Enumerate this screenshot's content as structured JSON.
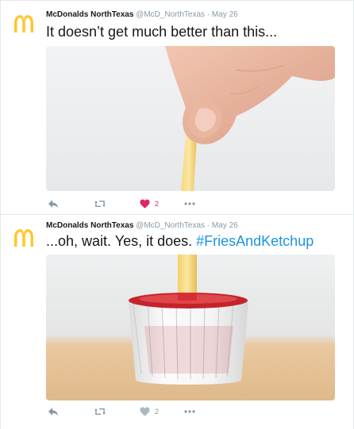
{
  "tweets": [
    {
      "author_name": "McDonalds NorthTexas",
      "handle": "@McD_NorthTexas",
      "separator": "·",
      "date": "May 26",
      "text": "It doesn’t get much better than this...",
      "hashtag": "",
      "media": "hand-holding-french-fry-photo",
      "like_count": "2",
      "liked": true
    },
    {
      "author_name": "McDonalds NorthTexas",
      "handle": "@McD_NorthTexas",
      "separator": "·",
      "date": "May 26",
      "text": "...oh, wait. Yes, it does. ",
      "hashtag": "#FriesAndKetchup",
      "media": "french-fry-in-ketchup-cup-photo",
      "like_count": "2",
      "liked": false
    }
  ],
  "colors": {
    "brand_yellow": "#ffc72c",
    "link_blue": "#1b95e0",
    "like_red": "#e0245e",
    "meta_gray": "#8899a6"
  }
}
